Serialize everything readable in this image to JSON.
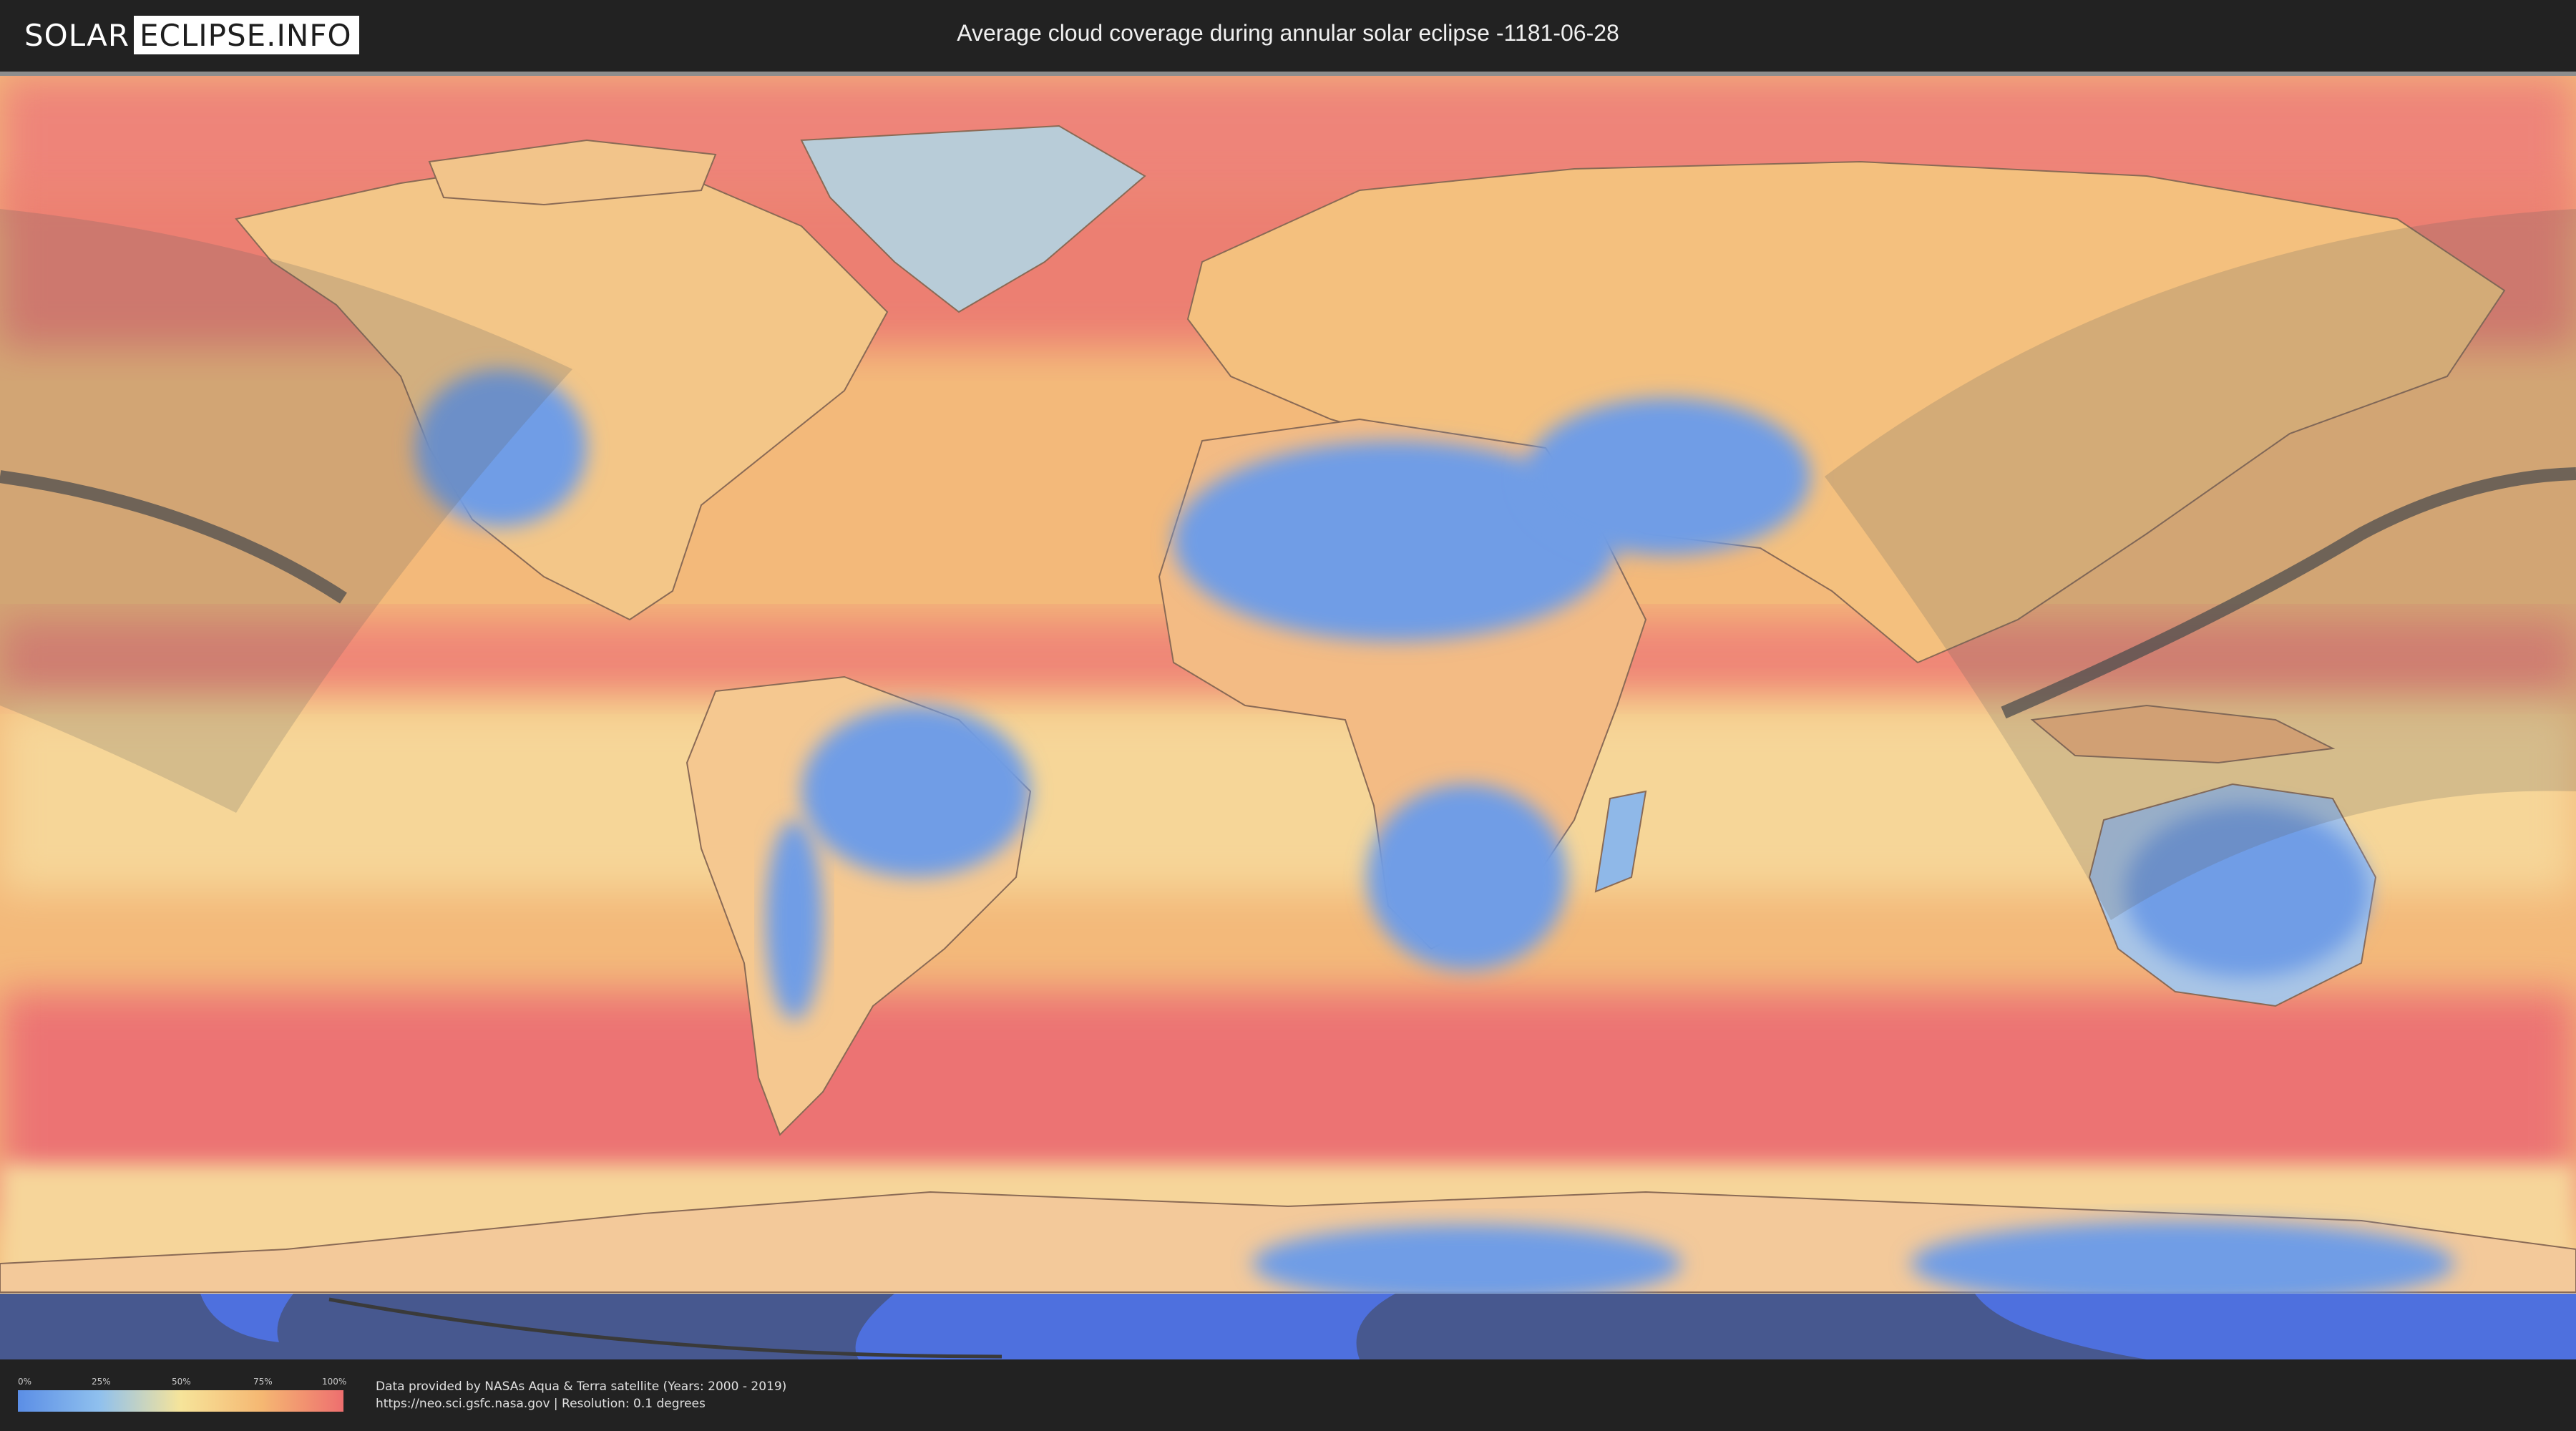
{
  "header": {
    "logo_part1": "SOLAR",
    "logo_part2": "ECLIPSE.INFO",
    "title": "Average cloud coverage during annular solar eclipse -1181-06-28"
  },
  "map": {
    "type": "cloud-coverage world map",
    "projection": "equirectangular",
    "eclipse_visibility_zones": 2,
    "central_path_lines": 2,
    "colors": {
      "low_cloud": "#5b8ee6",
      "mid_low": "#8fc0ee",
      "mid": "#f6e49a",
      "mid_high": "#f5b772",
      "high_cloud": "#ee6f6f",
      "polar_bottom": "#4e70de",
      "eclipse_shade": "#555555"
    }
  },
  "legend": {
    "ticks": [
      "0%",
      "25%",
      "50%",
      "75%",
      "100%"
    ],
    "gradient": [
      "#5b8ee6",
      "#8fc0ee",
      "#f6e49a",
      "#f5b772",
      "#ee6f6f"
    ]
  },
  "footer": {
    "credit_line1": "Data provided by NASAs Aqua & Terra satellite (Years: 2000 - 2019)",
    "credit_line2": "https://neo.sci.gsfc.nasa.gov | Resolution: 0.1 degrees"
  }
}
